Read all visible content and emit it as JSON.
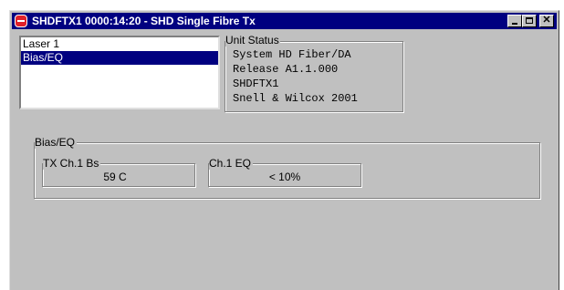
{
  "window": {
    "title": "SHDFTX1 0000:14:20 - SHD Single Fibre Tx",
    "app_icon": "snell-wilcox-app-icon",
    "controls": [
      "minimize-button",
      "maximize-button",
      "close-button"
    ],
    "close_glyph": "✕"
  },
  "list": {
    "items": [
      {
        "label": "Laser 1",
        "selected": false
      },
      {
        "label": "Bias/EQ",
        "selected": true
      }
    ]
  },
  "unit_status": {
    "label": "Unit Status",
    "lines": [
      "System HD Fiber/DA",
      "Release A1.1.000",
      "SHDFTX1",
      "Snell & Wilcox 2001"
    ]
  },
  "bias_eq": {
    "label": "Bias/EQ",
    "tx_bias": {
      "label": "TX Ch.1 Bs",
      "value": "59 C"
    },
    "ch1_eq": {
      "label": "Ch.1 EQ",
      "value": "< 10%"
    }
  },
  "colors": {
    "titlebar": "#000080",
    "face": "#c0c0c0",
    "selection": "#000080"
  }
}
